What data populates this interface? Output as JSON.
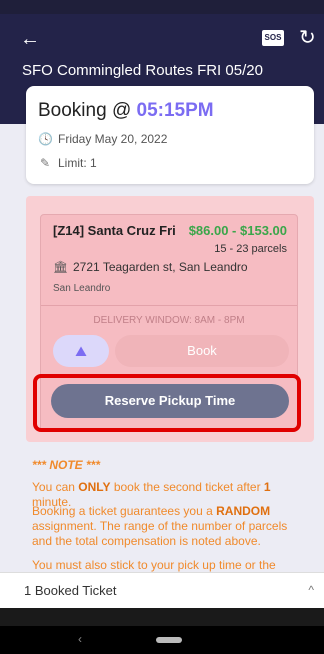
{
  "header": {
    "title": "SFO Commingled Routes FRI 05/20",
    "sos_label": "SOS"
  },
  "booking": {
    "label": "Booking @",
    "time": "05:15PM",
    "date": "Friday May 20, 2022",
    "limit": "Limit: 1"
  },
  "ticket": {
    "zone": "[Z14] Santa Cruz Fri",
    "price_range": "$86.00 - $153.00",
    "parcels": "15 - 23 parcels",
    "address": "2721 Teagarden st, San Leandro",
    "city": "San Leandro",
    "delivery_window": "DELIVERY WINDOW: 8AM - 8PM",
    "book_label": "Book",
    "reserve_label": "Reserve Pickup Time"
  },
  "note": {
    "heading": "*** NOTE ***",
    "line1_pre": "You can ",
    "line1_bold": "ONLY",
    "line1_mid": " book the second ticket after ",
    "line1_num": "1",
    "line1_post": " minute.",
    "line2_pre": "Booking a ticket guarantees you a ",
    "line2_bold": "RANDOM",
    "line2_post": " assignment. The range of the number of parcels and the total compensation is noted above.",
    "line3": "You must also stick to your pick up time or the ticket"
  },
  "bottom": {
    "booked_label": "1 Booked Ticket"
  },
  "colors": {
    "header_bg": "#232349",
    "accent": "#7b6cf2",
    "price": "#3aa64a",
    "ticket_bg": "#f6bcc2",
    "highlight": "#e00000",
    "note": "#f08a2c"
  }
}
